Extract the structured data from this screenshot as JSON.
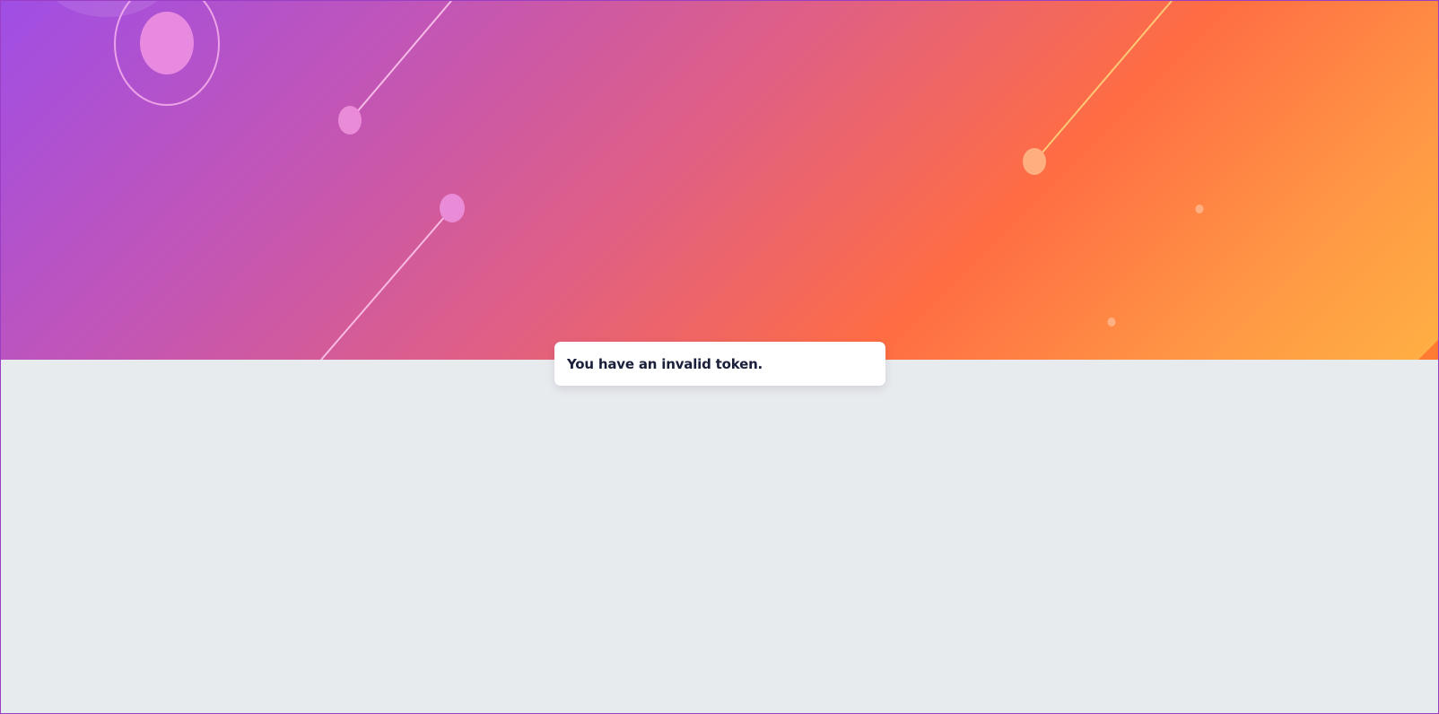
{
  "message": {
    "text": "You have an invalid token."
  },
  "colors": {
    "hero_gradient_start": "#9f4ee5",
    "hero_gradient_mid": "#ff6d43",
    "hero_gradient_end": "#ffb043",
    "page_background": "#e8ebee",
    "card_background": "#ffffff",
    "text": "#1a1f3a",
    "frame_border": "#9a3fc4"
  },
  "icons": [
    "orbit-circle-icon",
    "decorative-line-icon",
    "decorative-dot-icon"
  ]
}
